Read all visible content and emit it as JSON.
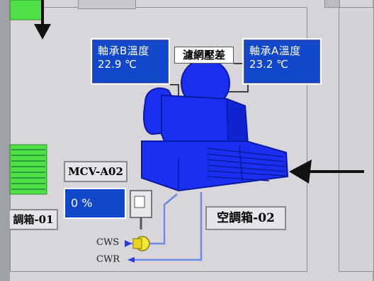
{
  "sensors": {
    "bearing_b": {
      "title": "軸承B溫度",
      "value": "22.9 ℃"
    },
    "bearing_a": {
      "title": "軸承A溫度",
      "value": "23.2 ℃"
    }
  },
  "filter_label": "濾網壓差",
  "mcv": {
    "name": "MCV-A02",
    "value": "0 %"
  },
  "ahu_left_label": "調箱-01",
  "ahu_main_label": "空調箱-02",
  "pipes": {
    "supply": "CWS",
    "return": "CWR"
  },
  "colors": {
    "unit_blue": "#1b2ff0",
    "panel_blue": "#1347c9",
    "left_unit_green": "#4fe04a"
  },
  "icons": [
    "arrow-down-icon",
    "arrow-left-icon",
    "valve-icon",
    "actuator-icon",
    "fan-icon"
  ]
}
